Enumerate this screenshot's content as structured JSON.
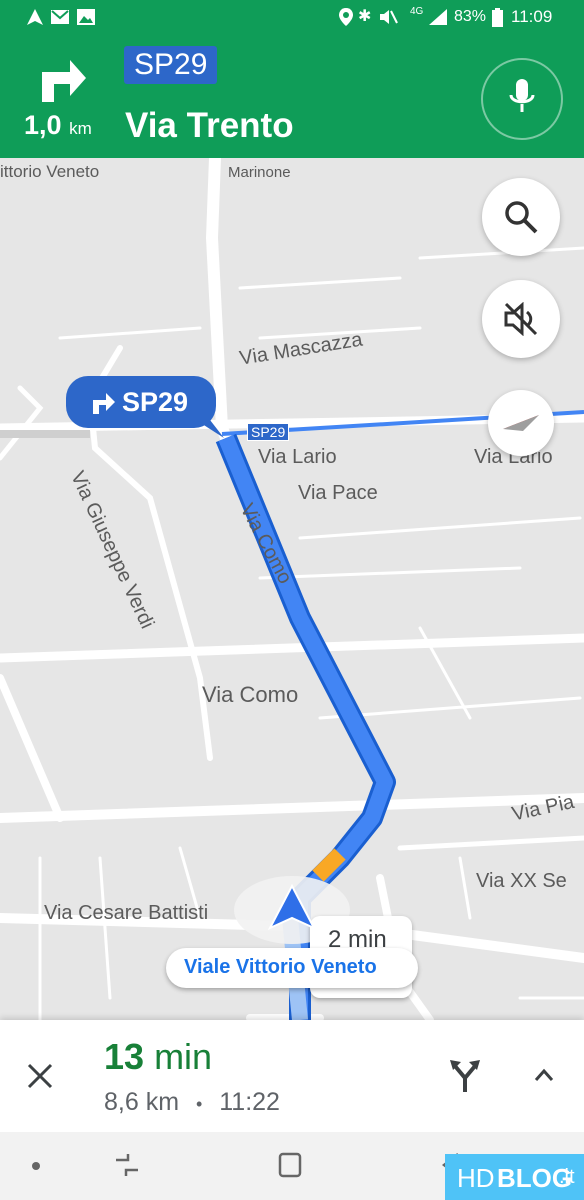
{
  "status_bar": {
    "battery": "83%",
    "time": "11:09",
    "network": "4G"
  },
  "nav_header": {
    "distance_value": "1,0",
    "distance_unit": "km",
    "route_shield": "SP29",
    "street_name": "Via Trento",
    "maneuver_icon": "turn-right-arrow",
    "mic_icon": "microphone"
  },
  "map": {
    "labels": {
      "vittorio_veneto_top": "ittorio Veneto",
      "marinone": "Marinone",
      "via_mascazza": "Via Mascazza",
      "via_lario_left": "Via Lario",
      "via_lario_right": "Via Lario",
      "via_pace": "Via Pace",
      "via_como_route": "Via Como",
      "via_giuseppe_verdi": "Via Giuseppe Verdi",
      "via_como": "Via Como",
      "via_cesare_battisti": "Via Cesare Battisti",
      "via_pia": "Via Pia",
      "via_xx_se": "Via XX Se",
      "route_shield_small": "SP29"
    },
    "turn_callout": "SP29",
    "time_bubble": "2 min",
    "location_label": "Viale Vittorio Veneto",
    "colors": {
      "route": "#4285f4",
      "route_border": "#1a5fd0",
      "traffic": "#f9a825"
    }
  },
  "bottom_panel": {
    "eta_minutes": "13",
    "eta_unit": "min",
    "distance": "8,6 km",
    "separator": "•",
    "arrival_time": "11:22"
  },
  "watermark": {
    "hd": "HD",
    "blog": "BLOG",
    "tld": ".it"
  }
}
